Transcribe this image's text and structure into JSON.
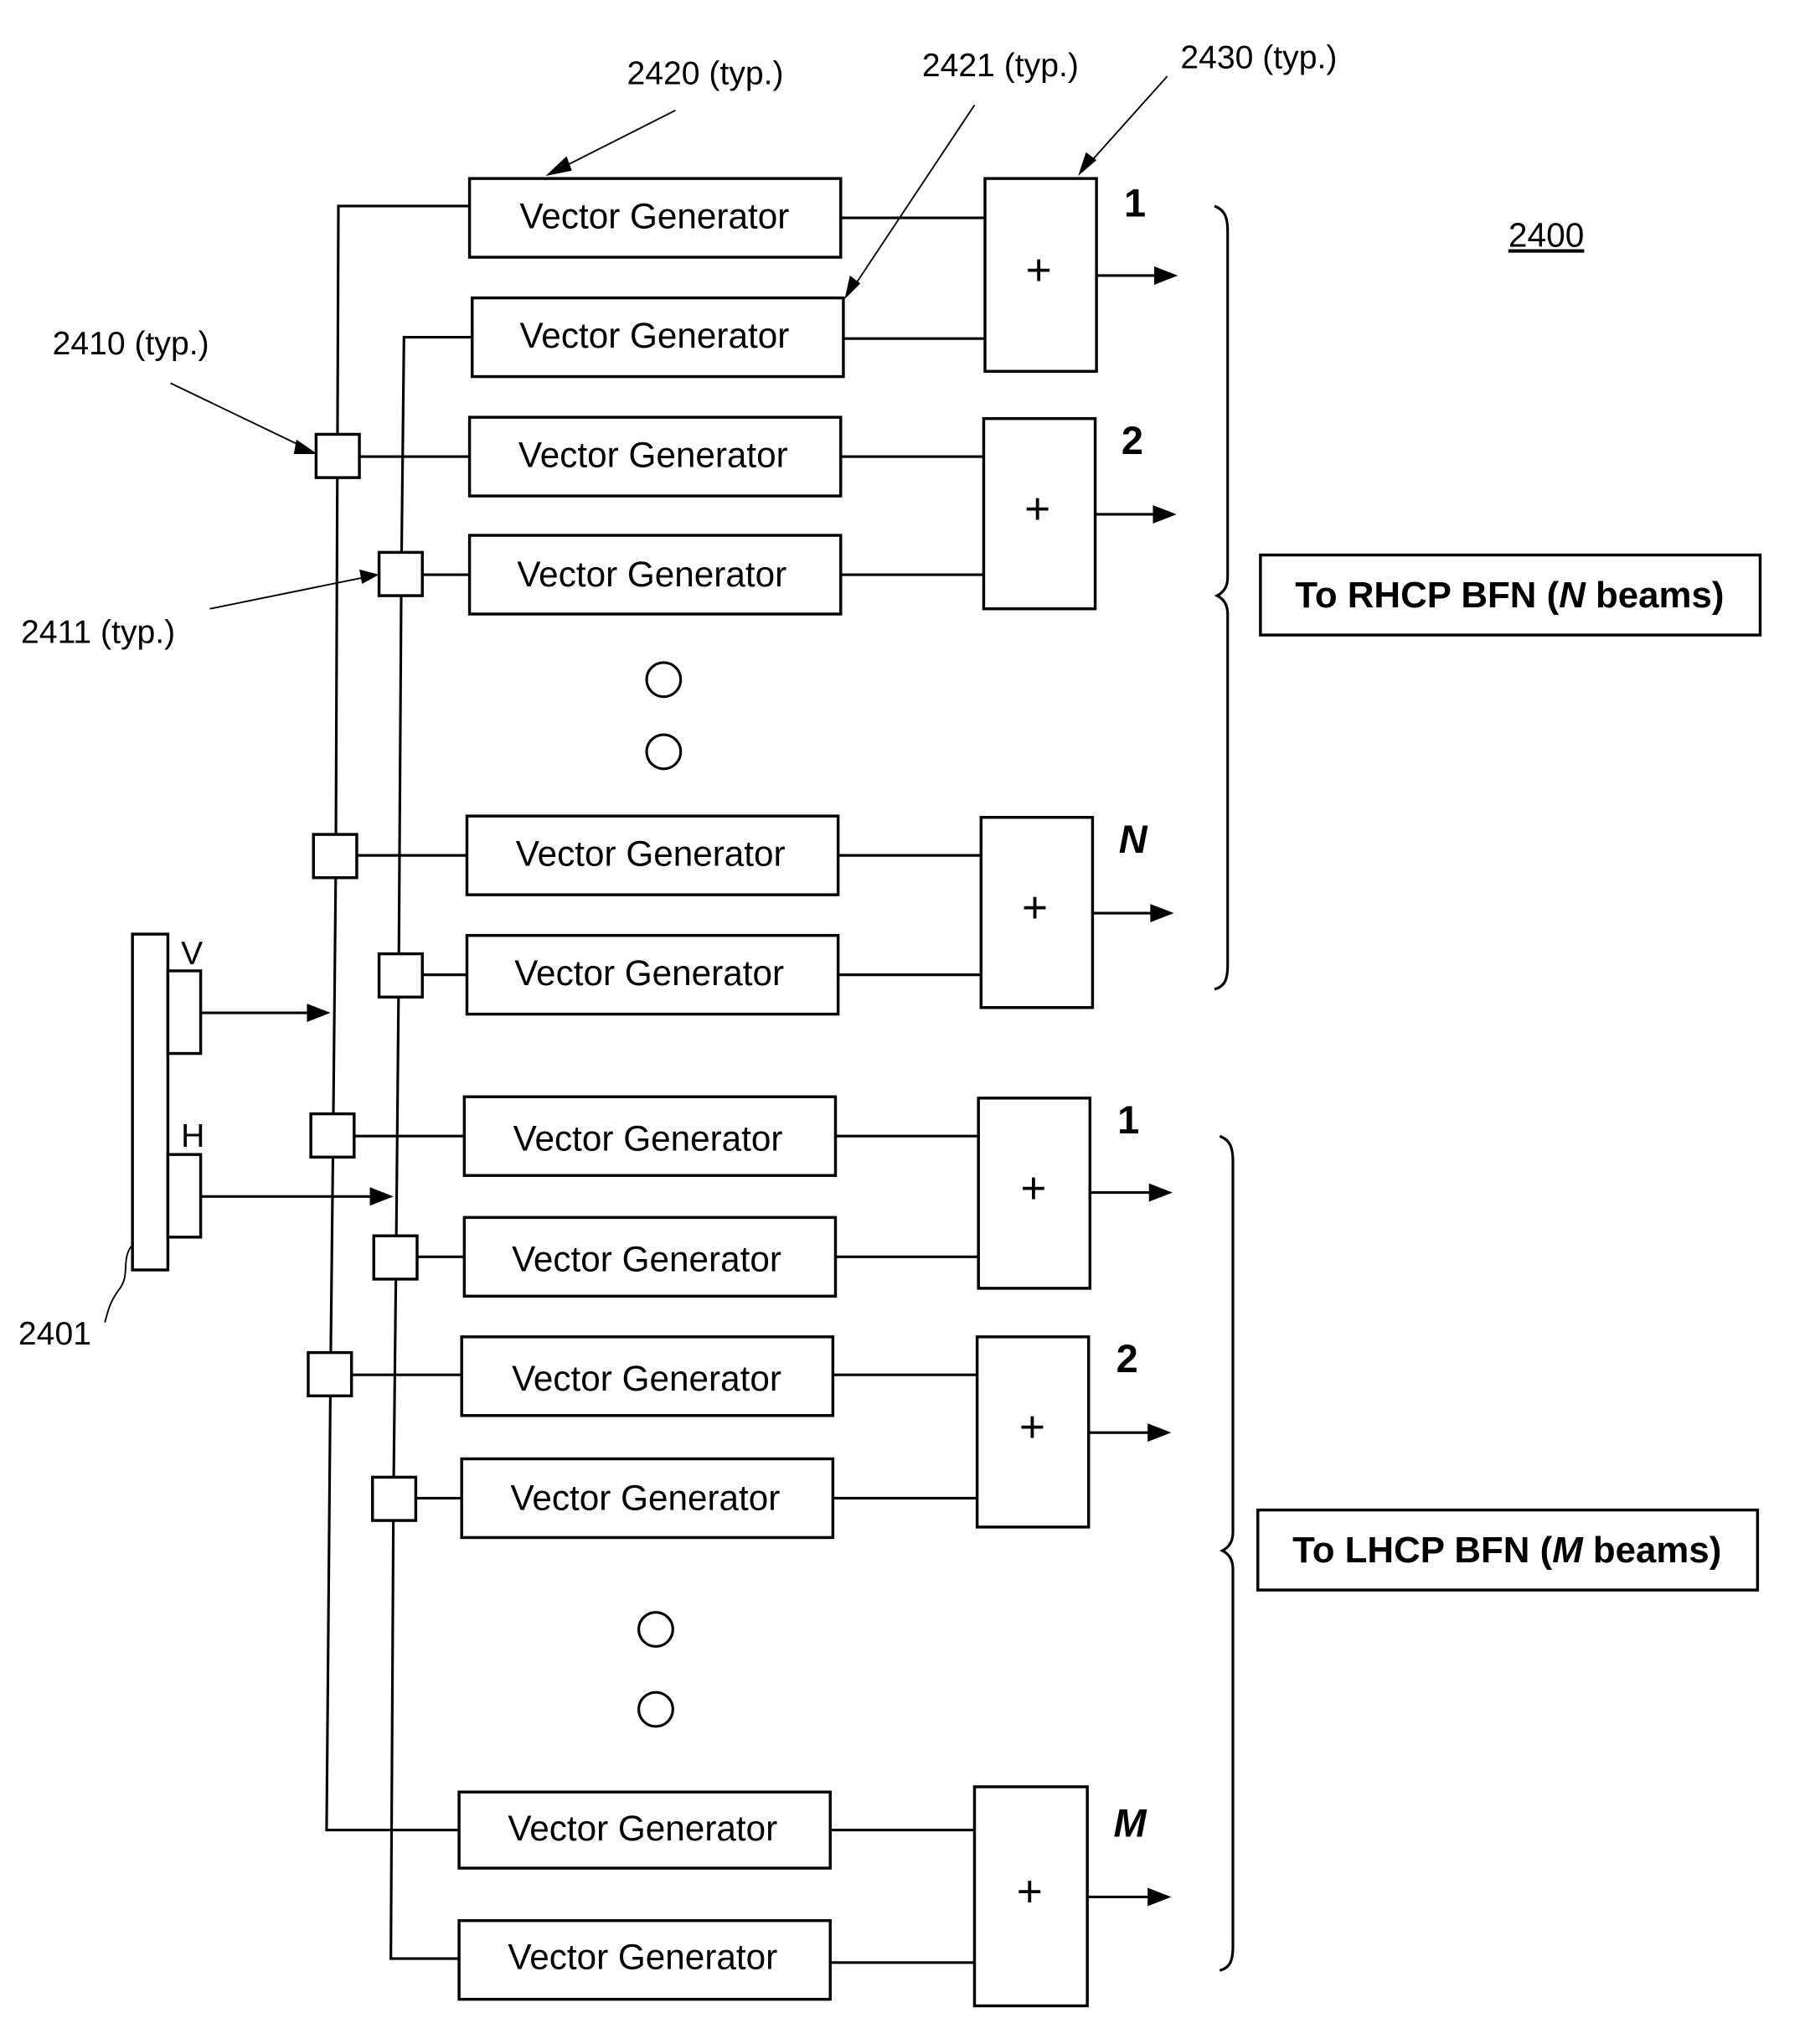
{
  "figure": {
    "number": "2400",
    "antenna_ref": "2401",
    "ports": {
      "v": "V",
      "h": "H"
    }
  },
  "callouts": {
    "vg_first": "2420 (typ.)",
    "vg_second": "2421 (typ.)",
    "summer": "2430 (typ.)",
    "splitter_v": "2410 (typ.)",
    "splitter_h": "2411 (typ.)"
  },
  "block": {
    "vector_generator": "Vector Generator",
    "summer_symbol": "+"
  },
  "groups": [
    {
      "name": "rhcp",
      "bfn_label": "To RHCP BFN (N beams)",
      "bfn_prefix": "To RHCP BFN (",
      "bfn_var": "N",
      "bfn_suffix": " beams)",
      "beams": [
        "1",
        "2",
        "N"
      ]
    },
    {
      "name": "lhcp",
      "bfn_label": "To LHCP BFN (M beams)",
      "bfn_prefix": "To LHCP BFN (",
      "bfn_var": "M",
      "bfn_suffix": " beams)",
      "beams": [
        "1",
        "2",
        "M"
      ]
    }
  ]
}
